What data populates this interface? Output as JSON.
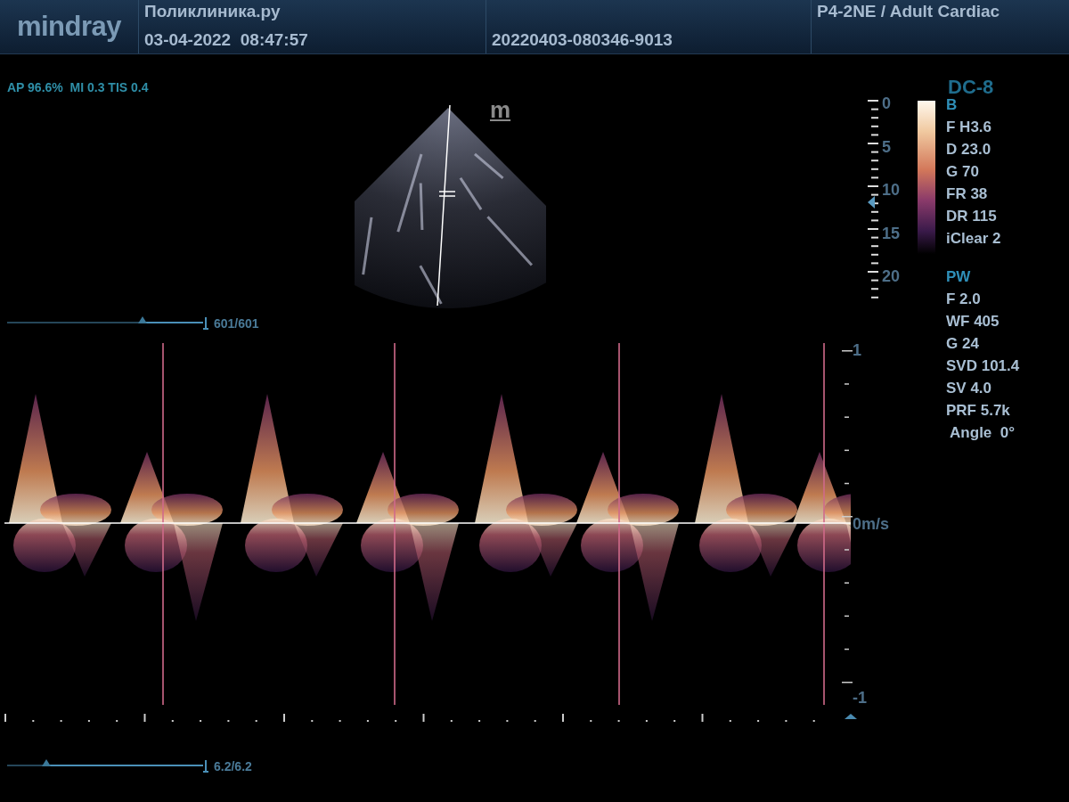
{
  "header": {
    "logo": "mindray",
    "clinic": "Поликлиника.ру",
    "datetime": "03-04-2022  08:47:57",
    "exam_id": "20220403-080346-9013",
    "probe_preset": "P4-2NE / Adult Cardiac"
  },
  "acoustic_output": "AP 96.6%  MI 0.3 TIS 0.4",
  "mode_marker": "m",
  "depth_scale": {
    "labels": [
      "0",
      "5",
      "10",
      "15",
      "20"
    ]
  },
  "cine_slider": {
    "level": 0.69,
    "reading": "601/601"
  },
  "velocity_scale": {
    "labels": [
      "1",
      "0m/s",
      "-1"
    ]
  },
  "sweep_slider": {
    "level": 0.2,
    "reading": "6.2/6.2"
  },
  "params": {
    "title": "DC-8",
    "sections": [
      {
        "heading": "B",
        "items": [
          "F H3.6",
          "D 23.0",
          "G 70",
          "FR 38",
          "DR 115",
          "iClear 2"
        ]
      },
      {
        "heading": "PW",
        "items": [
          "F 2.0",
          "WF 405",
          "G 24",
          "SVD 101.4",
          "SV 4.0",
          "PRF 5.7k",
          " Angle  0°"
        ]
      }
    ]
  }
}
